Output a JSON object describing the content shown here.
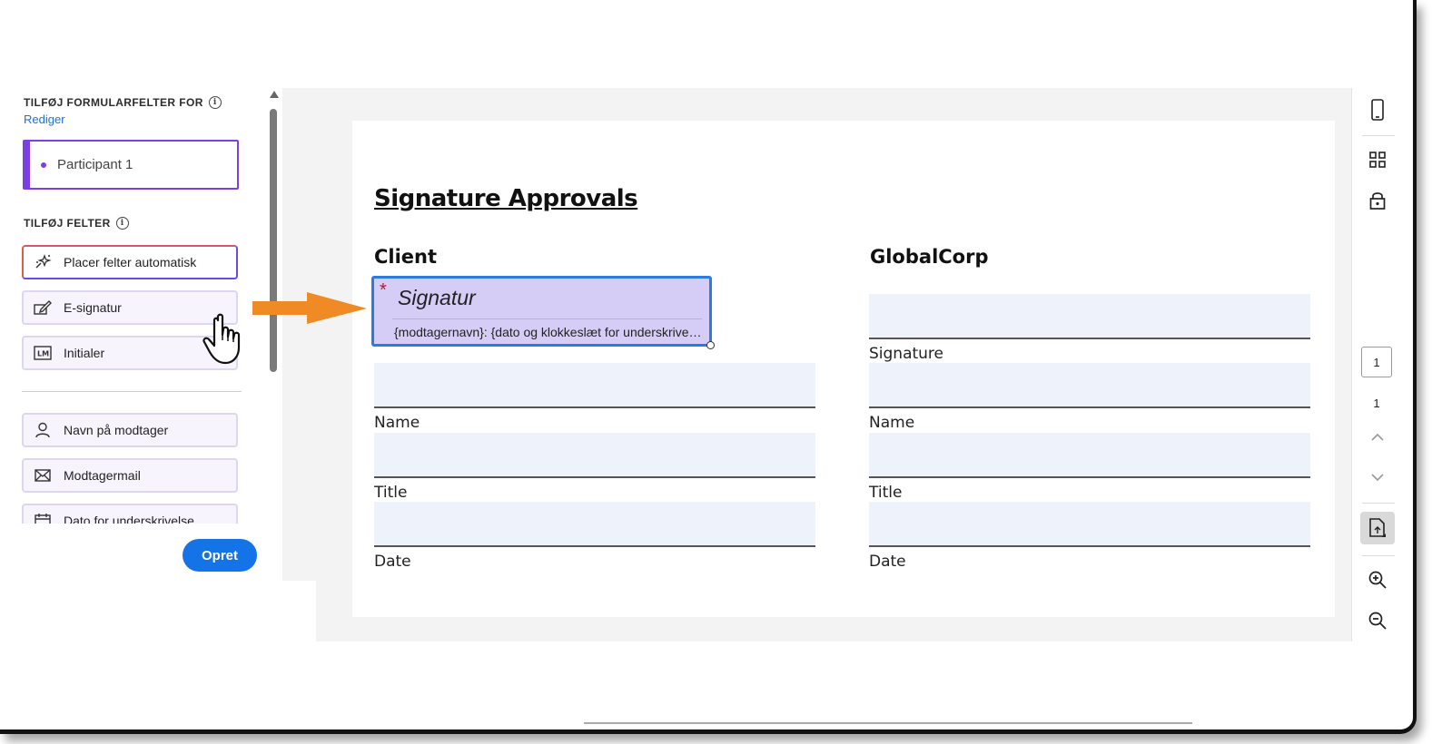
{
  "panel": {
    "add_form_fields_label": "TILFØJ FORMULARFELTER FOR",
    "edit_link": "Rediger",
    "participant": "Participant 1",
    "add_fields_label": "TILFØJ FELTER",
    "buttons": [
      {
        "label": "Placer felter automatisk",
        "icon": "auto-place-icon"
      },
      {
        "label": "E-signatur",
        "icon": "signature-icon"
      },
      {
        "label": "Initialer",
        "icon": "initials-icon"
      },
      {
        "label": "Navn på modtager",
        "icon": "person-icon"
      },
      {
        "label": "Modtagermail",
        "icon": "mail-icon"
      },
      {
        "label": "Dato for underskrivelse",
        "icon": "calendar-icon"
      }
    ],
    "create_button": "Opret"
  },
  "document": {
    "title": "Signature Approvals",
    "client_heading": "Client",
    "globalcorp_heading": "GlobalCorp",
    "labels": {
      "signature": "Signature",
      "name": "Name",
      "title": "Title",
      "date": "Date"
    },
    "signature_field": {
      "title": "Signatur",
      "required_marker": "*",
      "subtitle": "{modtagernavn}: {dato og klokkeslæt for underskrivelse}"
    }
  },
  "rail": {
    "current_page": "1",
    "total_pages": "1"
  },
  "colors": {
    "accent": "#1473e6",
    "participant": "#7b3fe4",
    "field_fill": "#d6cdf7",
    "arrow": "#f08a24"
  }
}
